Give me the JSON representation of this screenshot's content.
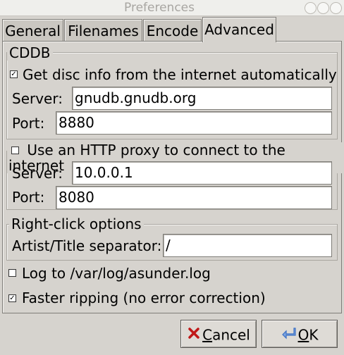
{
  "window": {
    "title": "Preferences"
  },
  "tabs": [
    {
      "label": "General"
    },
    {
      "label": "Filenames"
    },
    {
      "label": "Encode"
    },
    {
      "label": "Advanced"
    }
  ],
  "cddb": {
    "legend": "CDDB",
    "auto_label": "Get disc info from the internet automatically",
    "auto_checked": true,
    "server_label": "Server:",
    "server_value": "gnudb.gnudb.org",
    "port_label": "Port:",
    "port_value": "8880"
  },
  "proxy": {
    "label": "Use an HTTP proxy to connect to the internet",
    "checked": false,
    "server_label": "Server:",
    "server_value": "10.0.0.1",
    "port_label": "Port:",
    "port_value": "8080"
  },
  "rightclick": {
    "legend": "Right-click options",
    "separator_label": "Artist/Title separator:",
    "separator_value": "/"
  },
  "log": {
    "label": "Log to /var/log/asunder.log",
    "checked": false
  },
  "faster": {
    "label": "Faster ripping (no error correction)",
    "checked": true
  },
  "buttons": {
    "cancel_label": "Cancel",
    "cancel_mnemonic": "C",
    "cancel_rest": "ancel",
    "ok_label": "OK",
    "ok_mnemonic": "O",
    "ok_rest": "K"
  },
  "colors": {
    "background": "#d6d3ce",
    "entry_bg": "#ffffff",
    "cancel_icon": "#c01818",
    "ok_icon": "#3b6fc4"
  }
}
